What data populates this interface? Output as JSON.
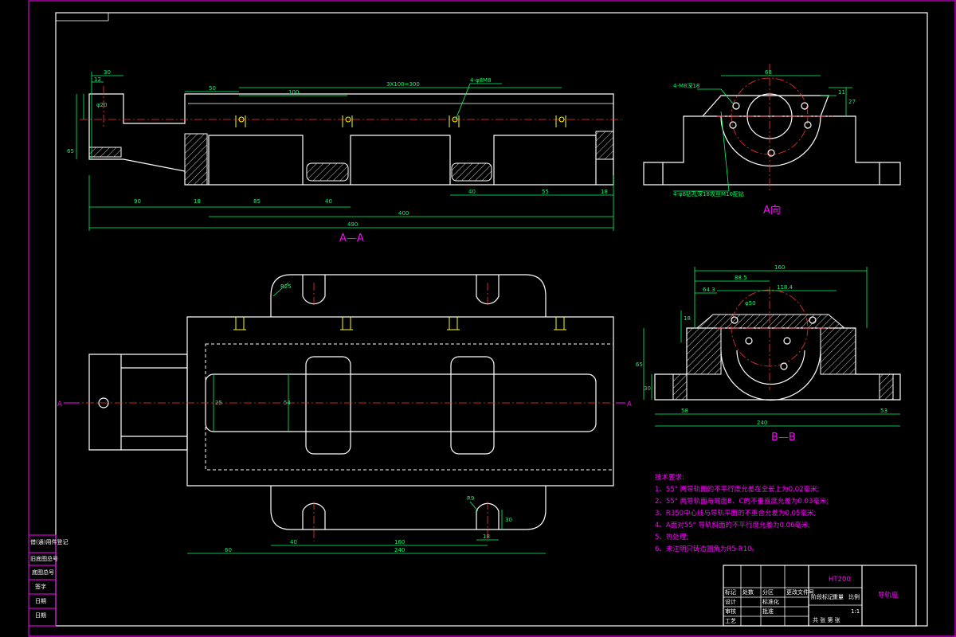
{
  "views": {
    "a_a": {
      "title": "A—A",
      "dims": {
        "d30": "30",
        "d12": "12",
        "d50": "50",
        "d100": "100",
        "d3x100": "3X100=300",
        "holes": "4-φ8M8",
        "d90": "90",
        "d18": "18",
        "d85": "85",
        "d40a": "40",
        "d40b": "40",
        "d55": "55",
        "d18b": "18",
        "d400": "400",
        "d490": "490",
        "d65": "65",
        "r20": "φ20"
      }
    },
    "a_dir": {
      "title": "A向",
      "dims": {
        "d68": "68",
        "d11": "11",
        "d27": "27",
        "note1": "4-M8深18",
        "note2": "4-φ8钻孔深18攻丝M10配钻"
      }
    },
    "b_b": {
      "title": "B—B",
      "dims": {
        "d160": "160",
        "d88": "88.5",
        "d118": "118.4",
        "d64": "64.3",
        "d50": "φ50",
        "d65": "65",
        "d58": "58",
        "d53": "53",
        "d240": "240",
        "d18": "18",
        "d30": "30"
      }
    },
    "plan": {
      "labels": {
        "a_left": "A",
        "a_right": "A"
      },
      "dims": {
        "r9": "R9",
        "r25": "R25",
        "d30": "30",
        "d18": "18",
        "d60": "60",
        "d40": "40",
        "d160": "160",
        "d240": "240",
        "d54": "54",
        "d25": "25"
      }
    }
  },
  "tech_notes": {
    "title": "技术要求:",
    "items": [
      "1、55° 两导轨面的不平行度允差在全长上为0.02毫米;",
      "2、55° 两导轨面与端面B、C的不垂直度允差为0.03毫米;",
      "3、R350中心线与导轨平面的不重合允差为0.05毫米;",
      "4、A面对55° 导轨斜面的不平行度允差为0.06毫米;",
      "5、热处理;",
      "6、未注明只铸造圆角为R5-R10。"
    ]
  },
  "left_strip": {
    "cells": [
      "借(通)用件登记",
      "旧底图总号",
      "底图总号",
      "签字",
      "日期",
      "日期"
    ]
  },
  "title_block": {
    "material": "HT200",
    "part_name": "导轨座",
    "scale": "1:1",
    "rows": [
      "标记",
      "处数",
      "分区",
      "更改文件号",
      "签名",
      "年月日"
    ],
    "roles": [
      "设计",
      "审核",
      "工艺",
      "标准化",
      "批准"
    ],
    "sheet": "共 张 第 张",
    "stage": [
      "阶段标记",
      "重量",
      "比例"
    ]
  },
  "colors": {
    "background": "#000000",
    "outline": "#ffffff",
    "dimension": "#00ff66",
    "centerline": "#ff3030",
    "frame": "#ff00ff",
    "thread": "#ffff00"
  }
}
